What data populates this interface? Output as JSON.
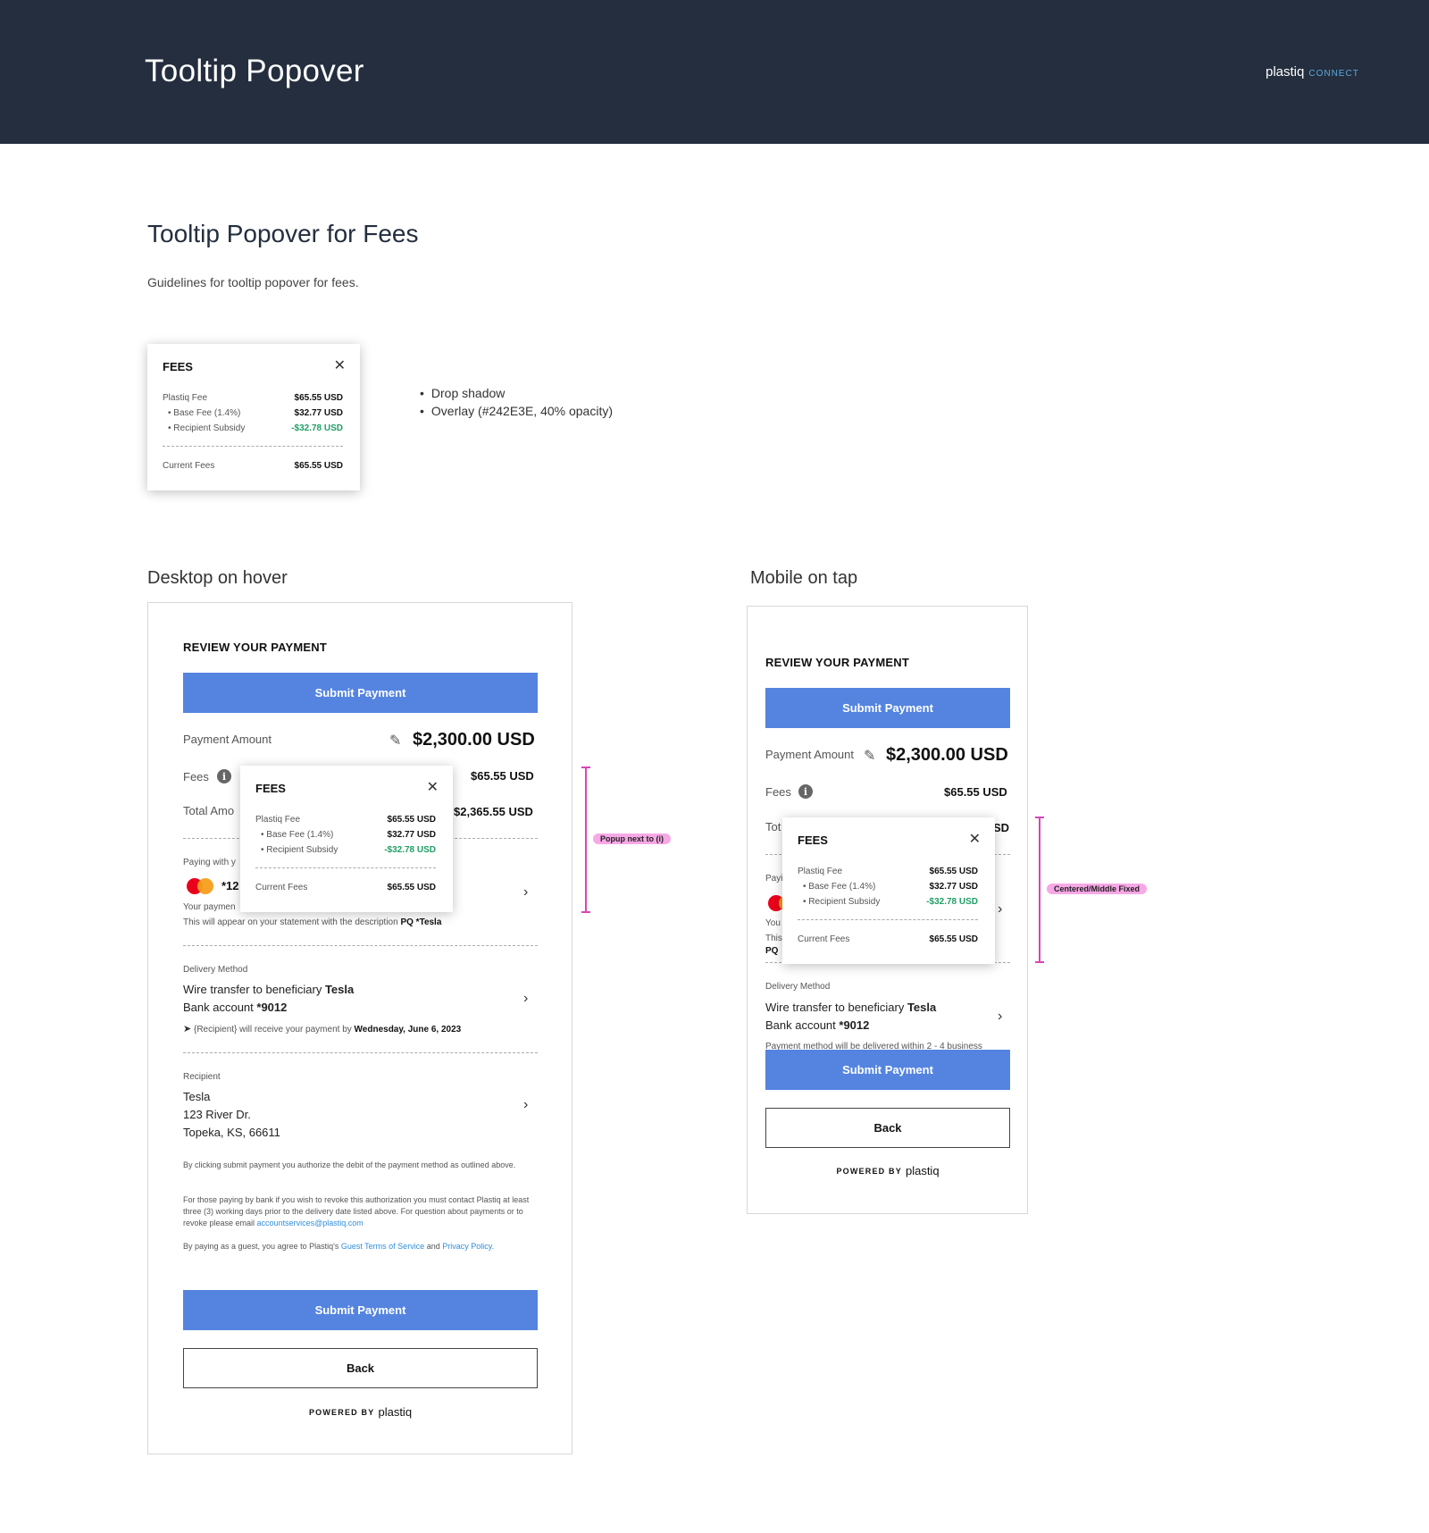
{
  "header": {
    "title": "Tooltip Popover",
    "brand": "plastiq",
    "brand_sub": "CONNECT"
  },
  "section": {
    "title": "Tooltip Popover for Fees",
    "description": "Guidelines for tooltip popover for fees."
  },
  "popover": {
    "title": "FEES",
    "rows": [
      {
        "label": "Plastiq Fee",
        "value": "$65.55 USD"
      },
      {
        "label": "Base Fee (1.4%)",
        "value": "$32.77 USD"
      },
      {
        "label": "Recipient Subsidy",
        "value": "-$32.78 USD"
      }
    ],
    "total_label": "Current Fees",
    "total_value": "$65.55 USD"
  },
  "notes": [
    "Drop shadow",
    "Overlay (#242E3E, 40% opacity)"
  ],
  "desktop": {
    "heading": "Desktop on hover",
    "review_title": "REVIEW YOUR PAYMENT",
    "submit": "Submit Payment",
    "payment_amount_label": "Payment Amount",
    "payment_amount": "$2,300.00 USD",
    "fees_label": "Fees",
    "fees_value": "$65.55 USD",
    "total_label": "Total Amo",
    "total_value": "$2,365.55 USD",
    "paying_label": "Paying with y",
    "card_last": "*12",
    "payment_note": "Your paymen",
    "statement_prefix": "This will appear on your statement with the description ",
    "statement_desc": "PQ *Tesla",
    "delivery_label": "Delivery Method",
    "delivery_line1_prefix": "Wire transfer to beneficiary ",
    "delivery_beneficiary": "Tesla",
    "delivery_line2_prefix": "Bank account ",
    "delivery_account": "*9012",
    "delivery_eta_prefix": "{Recipient} will receive your payment by ",
    "delivery_eta_date": "Wednesday, June 6, 2023",
    "recipient_label": "Recipient",
    "recipient_lines": [
      "Tesla",
      "123 River Dr.",
      "Topeka, KS, 66611"
    ],
    "legal1": "By clicking submit payment you authorize the debit of the payment method as outlined above.",
    "legal2": "For those paying by bank if you wish to revoke this authorization you must contact Plastiq at least three (3) working days prior to the delivery date listed above. For question about payments or to revoke please email ",
    "legal2_link": "accountservices@plastiq.com",
    "legal3_prefix": "By paying as a guest, you agree to Plastiq's ",
    "legal3_link1": "Guest Terms of Service",
    "legal3_mid": " and ",
    "legal3_link2": "Privacy Policy.",
    "back": "Back",
    "powered_by": "POWERED BY",
    "powered_logo": "plastiq",
    "annotation": "Popup next to (i)"
  },
  "mobile": {
    "heading": "Mobile on tap",
    "review_title": "REVIEW YOUR PAYMENT",
    "submit": "Submit Payment",
    "payment_amount_label": "Payment Amount",
    "payment_amount": "$2,300.00 USD",
    "fees_label": "Fees",
    "fees_value": "$65.55 USD",
    "total_label": "Tot",
    "total_value_cut": "SD",
    "paying_label": "Payi",
    "payment_note": "You",
    "statement": "This",
    "statement_desc": "PQ",
    "delivery_label": "Delivery Method",
    "delivery_line1_prefix": "Wire transfer to beneficiary ",
    "delivery_beneficiary": "Tesla",
    "delivery_line2_prefix": "Bank account ",
    "delivery_account": "*9012",
    "delivery_note": "Payment method will be delivered within 2 - 4 business",
    "back": "Back",
    "powered_by": "POWERED BY",
    "powered_logo": "plastiq",
    "annotation": "Centered/Middle Fixed"
  }
}
